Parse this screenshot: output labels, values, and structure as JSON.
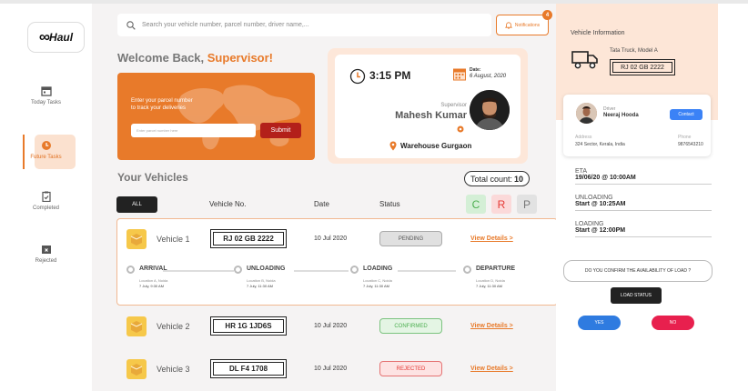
{
  "brand": {
    "logo_text": "Haul"
  },
  "nav": {
    "items": [
      {
        "label": "Today Tasks"
      },
      {
        "label": "Future Tasks"
      },
      {
        "label": "Completed"
      },
      {
        "label": "Rejected"
      }
    ]
  },
  "search": {
    "placeholder": "Search your vehicle number, parcel number, driver name,..."
  },
  "notifications": {
    "label": "Notifications",
    "count": "4"
  },
  "welcome": {
    "prefix": "Welcome Back, ",
    "role": "Supervisor!"
  },
  "track": {
    "line1": "Enter your parcel number",
    "line2": "to track your deliveries",
    "input_placeholder": "Enter parcel number here",
    "submit_label": "Submit"
  },
  "supervisor_card": {
    "time": "3:15 PM",
    "date_label": "Date:",
    "date_value": "6 August, 2020",
    "role_label": "Supervisor",
    "name": "Mahesh Kumar",
    "location": "Warehouse Gurgaon"
  },
  "vehicles": {
    "title": "Your Vehicles",
    "total_label": "Total count:",
    "total_value": "10",
    "filter_all": "ALL",
    "columns": {
      "vehicle_no": "Vehicle No.",
      "date": "Date",
      "status": "Status"
    },
    "filters": {
      "c": "C",
      "r": "R",
      "p": "P"
    },
    "rows": [
      {
        "name": "Vehicle 1",
        "plate": "RJ 02 GB 2222",
        "date": "10 Jul 2020",
        "status": "PENDING",
        "link": "View Details >"
      },
      {
        "name": "Vehicle 2",
        "plate": "HR 1G 1JD6S",
        "date": "10 Jul 2020",
        "status": "CONFIRMED",
        "link": "View Details >"
      },
      {
        "name": "Vehicle 3",
        "plate": "DL F4 1708",
        "date": "10 Jul 2020",
        "status": "REJECTED",
        "link": "View Details >"
      }
    ],
    "timeline": [
      {
        "name": "ARRIVAL",
        "location": "Location A, Noida",
        "time": "7 July, 9:30 AM"
      },
      {
        "name": "UNLOADING",
        "location": "Location B, Noida",
        "time": "7 July, 11:30 AM"
      },
      {
        "name": "LOADING",
        "location": "Location C, Noida",
        "time": "7 July, 11:30 AM"
      },
      {
        "name": "DEPARTURE",
        "location": "Location D, Noida",
        "time": "7 July, 11:30 AM"
      }
    ]
  },
  "vehicle_info": {
    "title": "Vehicle Information",
    "model": "Tata Truck, Model A",
    "plate": "RJ 02 GB 2222",
    "driver": {
      "label": "Driver",
      "name": "Neeraj Hooda",
      "contact_label": "Contact",
      "address_label": "Address",
      "address": "324 Sector, Kerala, India",
      "phone_label": "Phone",
      "phone": "9876543210"
    },
    "eta_label": "ETA",
    "eta_value": "19/06/20 @ 10:00AM",
    "unloading_label": "UNLOADING",
    "unloading_value": "Start @ 10:25AM",
    "loading_label": "LOADING",
    "loading_value": "Start @ 12:00PM",
    "confirm_question": "DO YOU CONFIRM THE AVAILABILITY OF LOAD ?",
    "load_status_label": "LOAD STATUS",
    "yes_label": "YES",
    "no_label": "NO"
  },
  "colors": {
    "accent": "#e87a2a",
    "submit": "#b3201a",
    "yes": "#2f7be0",
    "no": "#e8204e"
  }
}
